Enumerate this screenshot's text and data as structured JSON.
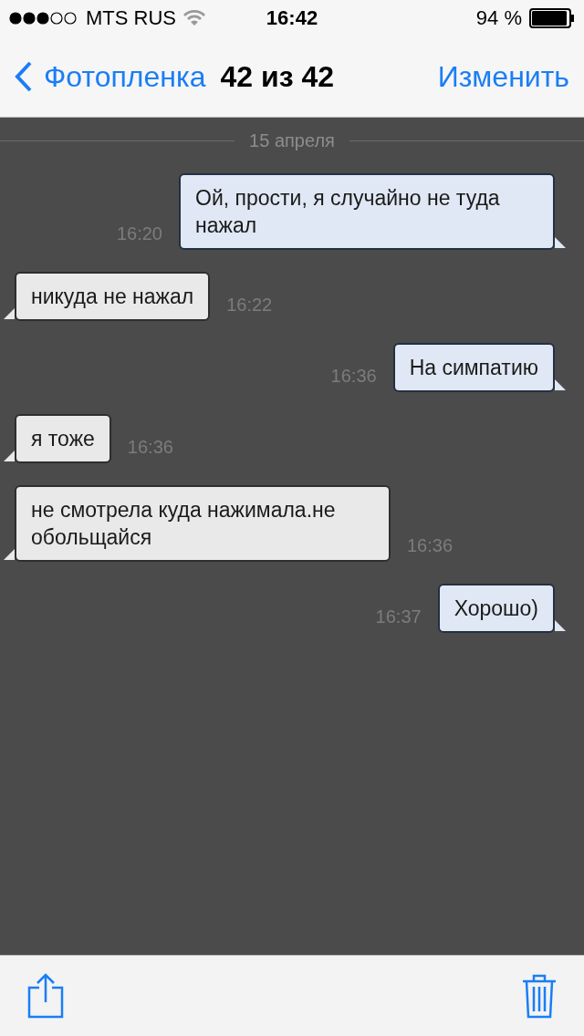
{
  "status_bar": {
    "carrier": "MTS RUS",
    "time": "16:42",
    "battery": "94 %"
  },
  "nav": {
    "back": "Фотопленка",
    "title": "42 из 42",
    "action": "Изменить"
  },
  "chat": {
    "date": "15 апреля",
    "messages": [
      {
        "kind": "outgoing",
        "text": "Ой, прости, я случайно не туда нажал",
        "time": "16:20"
      },
      {
        "kind": "incoming",
        "text": "никуда не нажал",
        "time": "16:22"
      },
      {
        "kind": "outgoing",
        "text": "На симпатию",
        "time": "16:36"
      },
      {
        "kind": "incoming",
        "text": "я тоже",
        "time": "16:36"
      },
      {
        "kind": "incoming",
        "text": "не смотрела куда нажимала.не обольщайся",
        "time": "16:36"
      },
      {
        "kind": "outgoing",
        "text": "Хорошо)",
        "time": "16:37"
      }
    ]
  }
}
